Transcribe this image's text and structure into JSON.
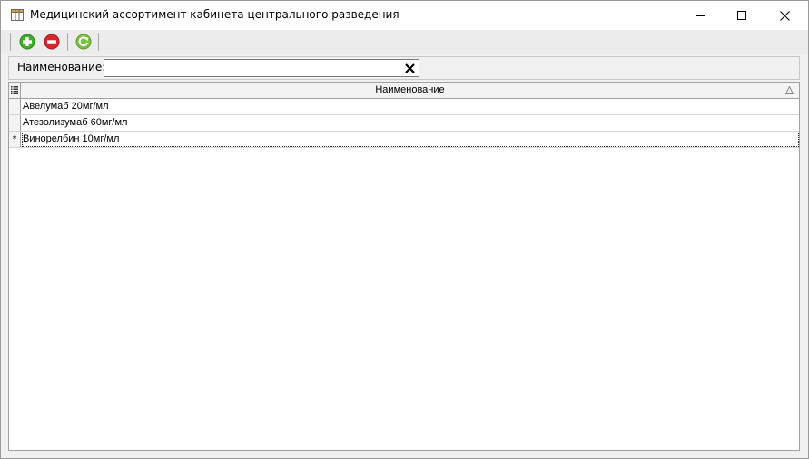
{
  "window": {
    "title": "Медицинский ассортимент кабинета центрального разведения",
    "icons": {
      "app": "table-icon",
      "minimize": "minimize-icon",
      "maximize": "maximize-icon",
      "close": "close-icon"
    }
  },
  "toolbar": {
    "buttons": [
      {
        "name": "add-button",
        "icon": "plus-circle-icon",
        "color": "#3fae29"
      },
      {
        "name": "delete-button",
        "icon": "minus-circle-icon",
        "color": "#d8262d"
      },
      {
        "name": "refresh-button",
        "icon": "refresh-icon",
        "color": "#7cc242"
      }
    ]
  },
  "filter": {
    "label": "Наименование:",
    "value": "",
    "placeholder": "",
    "clear_icon": "clear-x-icon"
  },
  "grid": {
    "corner_icon": "column-chooser-icon",
    "columns": [
      {
        "label": "Наименование",
        "sort": "ascending"
      }
    ],
    "rows": [
      {
        "name": "Авелумаб 20мг/мл",
        "current": false
      },
      {
        "name": "Атезолизумаб 60мг/мл",
        "current": false
      },
      {
        "name": "Винорелбин 10мг/мл",
        "current": true
      }
    ],
    "current_row_marker": "*"
  }
}
